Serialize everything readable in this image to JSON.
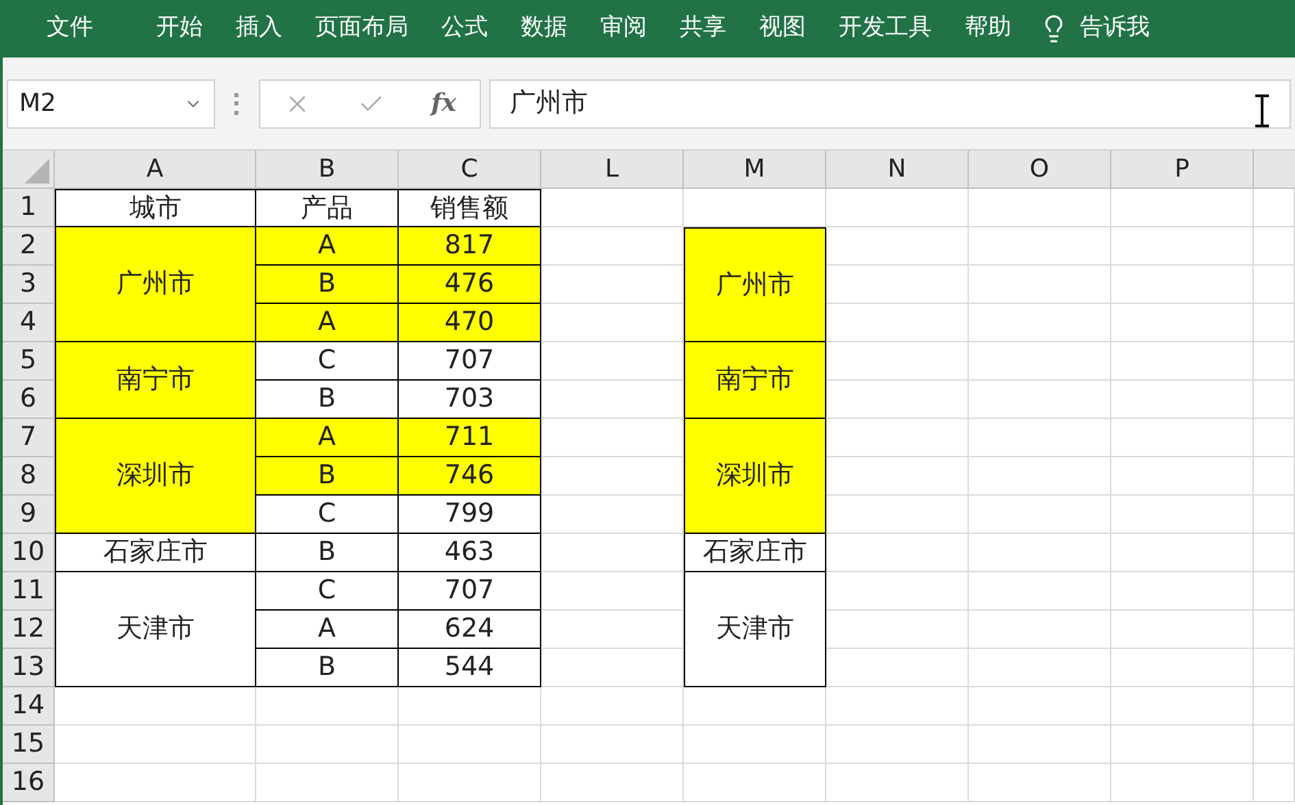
{
  "ribbon": {
    "tabs": [
      {
        "label": "文件",
        "selected": false
      },
      {
        "label": "开始",
        "selected": false
      },
      {
        "label": "插入",
        "selected": false
      },
      {
        "label": "页面布局",
        "selected": false
      },
      {
        "label": "公式",
        "selected": false
      },
      {
        "label": "数据",
        "selected": false
      },
      {
        "label": "审阅",
        "selected": false
      },
      {
        "label": "共享",
        "selected": false
      },
      {
        "label": "视图",
        "selected": false
      },
      {
        "label": "开发工具",
        "selected": false
      },
      {
        "label": "帮助",
        "selected": false
      }
    ],
    "tell_me": "告诉我"
  },
  "formula_bar": {
    "name_box": "M2",
    "function_label": "fx",
    "value": "广州市"
  },
  "sheet": {
    "columns": [
      "A",
      "B",
      "C",
      "L",
      "M",
      "N",
      "O",
      "P"
    ],
    "row_numbers": [
      "1",
      "2",
      "3",
      "4",
      "5",
      "6",
      "7",
      "8",
      "9",
      "10",
      "11",
      "12",
      "13",
      "14",
      "15",
      "16"
    ],
    "left_table": {
      "header": [
        "城市",
        "产品",
        "销售额"
      ],
      "groups": [
        {
          "city": "广州市",
          "highlighted": true,
          "rows": [
            {
              "product": "A",
              "amount": "817",
              "highlighted": true
            },
            {
              "product": "B",
              "amount": "476",
              "highlighted": true
            },
            {
              "product": "A",
              "amount": "470",
              "highlighted": true
            }
          ]
        },
        {
          "city": "南宁市",
          "highlighted": true,
          "rows": [
            {
              "product": "C",
              "amount": "707",
              "highlighted": false
            },
            {
              "product": "B",
              "amount": "703",
              "highlighted": false
            }
          ]
        },
        {
          "city": "深圳市",
          "highlighted": true,
          "rows": [
            {
              "product": "A",
              "amount": "711",
              "highlighted": true
            },
            {
              "product": "B",
              "amount": "746",
              "highlighted": true
            },
            {
              "product": "C",
              "amount": "799",
              "highlighted": false
            }
          ]
        },
        {
          "city": "石家庄市",
          "highlighted": false,
          "rows": [
            {
              "product": "B",
              "amount": "463",
              "highlighted": false
            }
          ]
        },
        {
          "city": "天津市",
          "highlighted": false,
          "rows": [
            {
              "product": "C",
              "amount": "707",
              "highlighted": false
            },
            {
              "product": "A",
              "amount": "624",
              "highlighted": false
            },
            {
              "product": "B",
              "amount": "544",
              "highlighted": false
            }
          ]
        }
      ]
    },
    "right_table": [
      {
        "city": "广州市",
        "highlighted": true
      },
      {
        "city": "南宁市",
        "highlighted": true
      },
      {
        "city": "深圳市",
        "highlighted": true
      },
      {
        "city": "石家庄市",
        "highlighted": false
      },
      {
        "city": "天津市",
        "highlighted": false
      }
    ]
  }
}
